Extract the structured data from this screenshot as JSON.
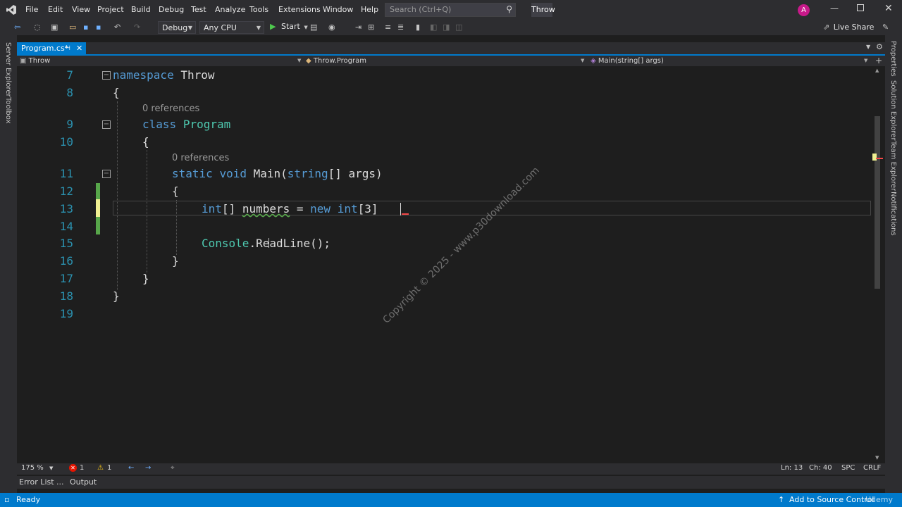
{
  "menu": {
    "items": [
      "File",
      "Edit",
      "View",
      "Project",
      "Build",
      "Debug",
      "Test",
      "Analyze",
      "Tools",
      "Extensions",
      "Window",
      "Help"
    ],
    "search_placeholder": "Search (Ctrl+Q)",
    "window_title": "Throw",
    "avatar_initial": "A"
  },
  "toolbar": {
    "config": "Debug",
    "platform": "Any CPU",
    "start_label": "Start",
    "live_share": "Live Share"
  },
  "left_rail": [
    "Server Explorer",
    "Toolbox"
  ],
  "right_rail": [
    "Properties",
    "Solution Explorer",
    "Team Explorer",
    "Notifications"
  ],
  "tab": {
    "label": "Program.cs*"
  },
  "navbar": {
    "project": "Throw",
    "type": "Throw.Program",
    "member": "Main(string[] args)"
  },
  "editor": {
    "line_numbers": [
      "7",
      "8",
      "9",
      "10",
      "11",
      "12",
      "13",
      "14",
      "15",
      "16",
      "17",
      "18",
      "19"
    ],
    "hint_refs": "0 references",
    "code": {
      "l7_kw": "namespace",
      "l7_name": "Throw",
      "brace_open": "{",
      "brace_close": "}",
      "l9_kw": "class",
      "l9_name": "Program",
      "l11_kw1": "static",
      "l11_kw2": "void",
      "l11_rest": "Main(",
      "l11_kw3": "string",
      "l11_tail": "[] args)",
      "l13_kw": "int",
      "l13_a": "[] ",
      "l13_var": "numbers",
      "l13_b": " = ",
      "l13_new": "new",
      "l13_kw2": "int",
      "l13_tail": "[3] ",
      "l15_type": "Console",
      "l15_tail": ".ReadLine();"
    },
    "watermark": "Copyright © 2025 - www.p30download.com"
  },
  "bottom": {
    "zoom": "175 %",
    "errors": "1",
    "warnings": "1",
    "position_line": "Ln: 13",
    "position_col": "Ch: 40",
    "spacing": "SPC",
    "line_ending": "CRLF"
  },
  "panels": {
    "error_list": "Error List ...",
    "output": "Output"
  },
  "status": {
    "ready": "Ready",
    "source_control": "Add to Source Control",
    "branding": "Udemy"
  },
  "colors": {
    "accent": "#007acc",
    "keyword": "#569cd6",
    "type": "#4ec9b0",
    "line_number": "#2b91af"
  }
}
